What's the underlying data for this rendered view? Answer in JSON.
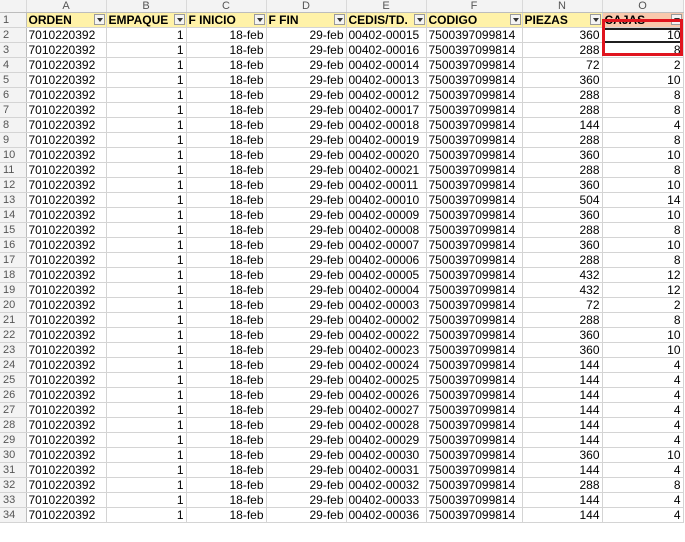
{
  "column_letters": [
    "",
    "A",
    "B",
    "C",
    "D",
    "E",
    "F",
    "N",
    "O"
  ],
  "header_row_number": "1",
  "headers": [
    "ORDEN",
    "EMPAQUE",
    "F INICIO",
    "F FIN",
    "CEDIS/TD.",
    "CODIGO",
    "PIEZAS",
    "CAJAS"
  ],
  "highlight_color": "#e0141e",
  "header_fill": "#fff2a8",
  "cajas_header_fill": "#f9c8ac",
  "rows": [
    [
      "2",
      "7010220392",
      "1",
      "18-feb",
      "29-feb",
      "00402-00015",
      "7500397099814",
      "360",
      "10"
    ],
    [
      "3",
      "7010220392",
      "1",
      "18-feb",
      "29-feb",
      "00402-00016",
      "7500397099814",
      "288",
      "8"
    ],
    [
      "4",
      "7010220392",
      "1",
      "18-feb",
      "29-feb",
      "00402-00014",
      "7500397099814",
      "72",
      "2"
    ],
    [
      "5",
      "7010220392",
      "1",
      "18-feb",
      "29-feb",
      "00402-00013",
      "7500397099814",
      "360",
      "10"
    ],
    [
      "6",
      "7010220392",
      "1",
      "18-feb",
      "29-feb",
      "00402-00012",
      "7500397099814",
      "288",
      "8"
    ],
    [
      "7",
      "7010220392",
      "1",
      "18-feb",
      "29-feb",
      "00402-00017",
      "7500397099814",
      "288",
      "8"
    ],
    [
      "8",
      "7010220392",
      "1",
      "18-feb",
      "29-feb",
      "00402-00018",
      "7500397099814",
      "144",
      "4"
    ],
    [
      "9",
      "7010220392",
      "1",
      "18-feb",
      "29-feb",
      "00402-00019",
      "7500397099814",
      "288",
      "8"
    ],
    [
      "10",
      "7010220392",
      "1",
      "18-feb",
      "29-feb",
      "00402-00020",
      "7500397099814",
      "360",
      "10"
    ],
    [
      "11",
      "7010220392",
      "1",
      "18-feb",
      "29-feb",
      "00402-00021",
      "7500397099814",
      "288",
      "8"
    ],
    [
      "12",
      "7010220392",
      "1",
      "18-feb",
      "29-feb",
      "00402-00011",
      "7500397099814",
      "360",
      "10"
    ],
    [
      "13",
      "7010220392",
      "1",
      "18-feb",
      "29-feb",
      "00402-00010",
      "7500397099814",
      "504",
      "14"
    ],
    [
      "14",
      "7010220392",
      "1",
      "18-feb",
      "29-feb",
      "00402-00009",
      "7500397099814",
      "360",
      "10"
    ],
    [
      "15",
      "7010220392",
      "1",
      "18-feb",
      "29-feb",
      "00402-00008",
      "7500397099814",
      "288",
      "8"
    ],
    [
      "16",
      "7010220392",
      "1",
      "18-feb",
      "29-feb",
      "00402-00007",
      "7500397099814",
      "360",
      "10"
    ],
    [
      "17",
      "7010220392",
      "1",
      "18-feb",
      "29-feb",
      "00402-00006",
      "7500397099814",
      "288",
      "8"
    ],
    [
      "18",
      "7010220392",
      "1",
      "18-feb",
      "29-feb",
      "00402-00005",
      "7500397099814",
      "432",
      "12"
    ],
    [
      "19",
      "7010220392",
      "1",
      "18-feb",
      "29-feb",
      "00402-00004",
      "7500397099814",
      "432",
      "12"
    ],
    [
      "20",
      "7010220392",
      "1",
      "18-feb",
      "29-feb",
      "00402-00003",
      "7500397099814",
      "72",
      "2"
    ],
    [
      "21",
      "7010220392",
      "1",
      "18-feb",
      "29-feb",
      "00402-00002",
      "7500397099814",
      "288",
      "8"
    ],
    [
      "22",
      "7010220392",
      "1",
      "18-feb",
      "29-feb",
      "00402-00022",
      "7500397099814",
      "360",
      "10"
    ],
    [
      "23",
      "7010220392",
      "1",
      "18-feb",
      "29-feb",
      "00402-00023",
      "7500397099814",
      "360",
      "10"
    ],
    [
      "24",
      "7010220392",
      "1",
      "18-feb",
      "29-feb",
      "00402-00024",
      "7500397099814",
      "144",
      "4"
    ],
    [
      "25",
      "7010220392",
      "1",
      "18-feb",
      "29-feb",
      "00402-00025",
      "7500397099814",
      "144",
      "4"
    ],
    [
      "26",
      "7010220392",
      "1",
      "18-feb",
      "29-feb",
      "00402-00026",
      "7500397099814",
      "144",
      "4"
    ],
    [
      "27",
      "7010220392",
      "1",
      "18-feb",
      "29-feb",
      "00402-00027",
      "7500397099814",
      "144",
      "4"
    ],
    [
      "28",
      "7010220392",
      "1",
      "18-feb",
      "29-feb",
      "00402-00028",
      "7500397099814",
      "144",
      "4"
    ],
    [
      "29",
      "7010220392",
      "1",
      "18-feb",
      "29-feb",
      "00402-00029",
      "7500397099814",
      "144",
      "4"
    ],
    [
      "30",
      "7010220392",
      "1",
      "18-feb",
      "29-feb",
      "00402-00030",
      "7500397099814",
      "360",
      "10"
    ],
    [
      "31",
      "7010220392",
      "1",
      "18-feb",
      "29-feb",
      "00402-00031",
      "7500397099814",
      "144",
      "4"
    ],
    [
      "32",
      "7010220392",
      "1",
      "18-feb",
      "29-feb",
      "00402-00032",
      "7500397099814",
      "288",
      "8"
    ],
    [
      "33",
      "7010220392",
      "1",
      "18-feb",
      "29-feb",
      "00402-00033",
      "7500397099814",
      "144",
      "4"
    ],
    [
      "34",
      "7010220392",
      "1",
      "18-feb",
      "29-feb",
      "00402-00036",
      "7500397099814",
      "144",
      "4"
    ]
  ]
}
